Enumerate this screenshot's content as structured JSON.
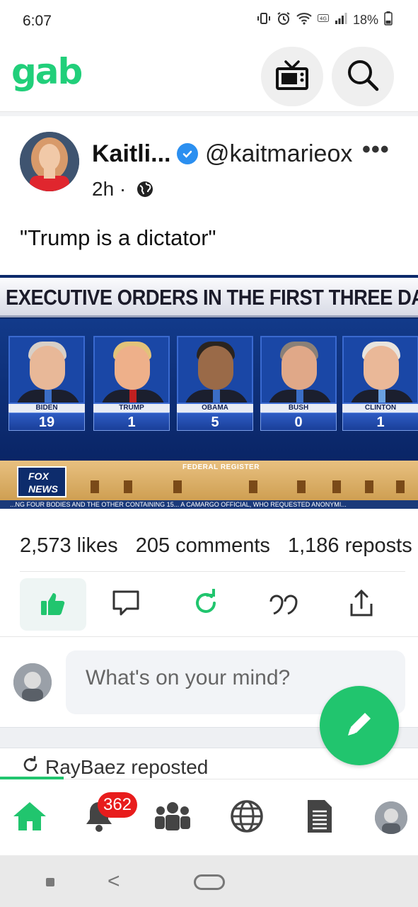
{
  "status_bar": {
    "time": "6:07",
    "battery": "18%",
    "icons": [
      "vibrate-icon",
      "alarm-icon",
      "wifi-icon",
      "4g-icon",
      "signal-icon",
      "battery-icon"
    ]
  },
  "header": {
    "logo": "gab",
    "buttons": [
      "tv-icon",
      "search-icon"
    ]
  },
  "post": {
    "author_name": "Kaitli...",
    "author_handle": "@kaitmarieox",
    "verified": true,
    "more": "•••",
    "time": "2h ·",
    "text": "\"Trump is a dictator\"",
    "image": {
      "banner": "EXECUTIVE ORDERS IN THE FIRST THREE DAYS",
      "presidents": [
        {
          "name": "BIDEN",
          "value": "19"
        },
        {
          "name": "TRUMP",
          "value": "1"
        },
        {
          "name": "OBAMA",
          "value": "5"
        },
        {
          "name": "BUSH",
          "value": "0"
        },
        {
          "name": "CLINTON",
          "value": "1"
        }
      ],
      "podium": "FEDERAL REGISTER",
      "network_logo": "FOX NEWS",
      "ticker": "...NG FOUR BODIES AND THE OTHER CONTAINING 15...   A CAMARGO OFFICIAL, WHO REQUESTED ANONYMI..."
    },
    "stats": {
      "likes": "2,573 likes",
      "comments": "205 comments",
      "reposts": "1,186 reposts"
    },
    "actions": [
      "like-icon",
      "comment-icon",
      "repost-icon",
      "quote-icon",
      "share-icon"
    ]
  },
  "composer": {
    "placeholder": "What's on your mind?"
  },
  "next_post": {
    "repost_label": "RayBaez reposted"
  },
  "bottom_nav": {
    "items": [
      "home-icon",
      "notifications-icon",
      "groups-icon",
      "explore-icon",
      "news-icon",
      "profile-avatar"
    ],
    "notification_count": "362"
  },
  "colors": {
    "brand_green": "#21cf7a",
    "fab_green": "#21c56e",
    "badge_red": "#e81c1c",
    "verified_blue": "#2b8ff0"
  }
}
